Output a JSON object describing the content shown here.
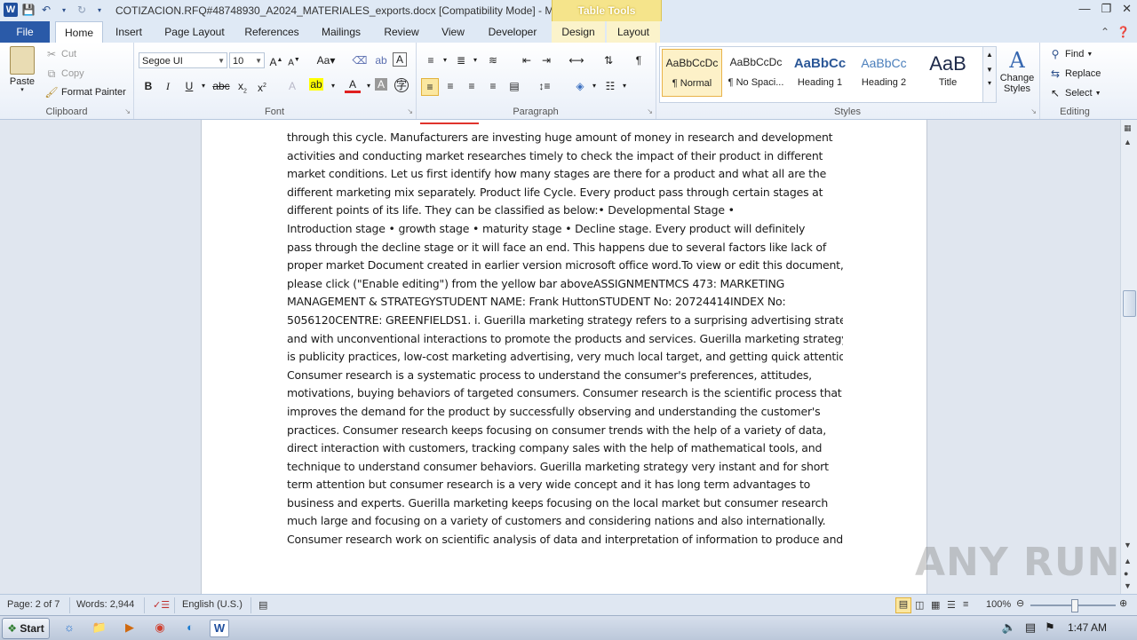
{
  "window": {
    "title": "COTIZACION.RFQ#48748930_A2024_MATERIALES_exports.docx [Compatibility Mode] - Micr...",
    "contextual_group": "Table Tools"
  },
  "tabs": {
    "file": "File",
    "home": "Home",
    "insert": "Insert",
    "page_layout": "Page Layout",
    "references": "References",
    "mailings": "Mailings",
    "review": "Review",
    "view": "View",
    "developer": "Developer",
    "design": "Design",
    "layout": "Layout"
  },
  "ribbon": {
    "clipboard": {
      "label": "Clipboard",
      "paste": "Paste",
      "cut": "Cut",
      "copy": "Copy",
      "format_painter": "Format Painter"
    },
    "font": {
      "label": "Font",
      "font_name": "Segoe UI",
      "font_size": "10"
    },
    "paragraph": {
      "label": "Paragraph"
    },
    "styles": {
      "label": "Styles",
      "items": [
        {
          "sample": "AaBbCcDc",
          "name": "¶ Normal"
        },
        {
          "sample": "AaBbCcDc",
          "name": "¶ No Spaci..."
        },
        {
          "sample": "AaBbCc",
          "name": "Heading 1"
        },
        {
          "sample": "AaBbCc",
          "name": "Heading 2"
        },
        {
          "sample": "AaB",
          "name": "Title"
        }
      ],
      "change_styles": "Change Styles"
    },
    "editing": {
      "label": "Editing",
      "find": "Find",
      "replace": "Replace",
      "select": "Select"
    }
  },
  "document": {
    "lines": [
      "through this cycle. Manufacturers are investing huge amount of money in research and development",
      "activities and conducting market researches timely to check the impact of their product in different",
      "market conditions. Let us first identify how many stages are there for a product and what all are the",
      "different marketing mix separately. Product life Cycle. Every product pass through certain stages at",
      "different points of its life. They can be classified as below:•          Developmental Stage •",
      "Introduction stage •     growth stage •  maturity stage •          Decline stage. Every product will definitely",
      "pass through the decline stage or it will face an end. This happens due to several factors like lack of",
      "proper market Document created in earlier version microsoft office word.To view or edit this document,",
      "please click (\"Enable editing\") from the yellow bar aboveASSIGNMENTMCS 473: MARKETING",
      "MANAGEMENT & STRATEGYSTUDENT NAME: Frank HuttonSTUDENT No: 20724414INDEX  No:",
      "5056120CENTRE:  GREENFIELDS1. i. Guerilla marketing strategy refers to a surprising advertising strategy",
      "and with unconventional interactions to promote the products and services. Guerilla marketing strategy",
      "is publicity practices, low-cost marketing advertising, very much local target, and getting quick attention.",
      "Consumer research is a systematic process to understand the consumer's preferences, attitudes,",
      "motivations, buying behaviors of targeted consumers. Consumer research is the scientific process that",
      "improves the demand for the product by successfully observing and understanding the customer's",
      "practices. Consumer research keeps focusing on consumer trends with the help of a variety of data,",
      "direct interaction with customers, tracking company sales with the help of mathematical tools, and",
      "technique to understand consumer behaviors. Guerilla marketing strategy very instant and for short",
      "term attention but consumer research is a very wide concept and it has long term advantages to",
      "business and experts. Guerilla marketing keeps focusing on the local market but consumer research",
      "much large and focusing on a  variety of customers and considering nations and also internationally.",
      "Consumer research work on scientific analysis of data and interpretation of information to produce and"
    ]
  },
  "status": {
    "page": "Page: 2 of 7",
    "words": "Words: 2,944",
    "language": "English (U.S.)",
    "zoom": "100%"
  },
  "taskbar": {
    "start": "Start",
    "clock": "1:47 AM"
  },
  "watermark": "ANY RUN"
}
